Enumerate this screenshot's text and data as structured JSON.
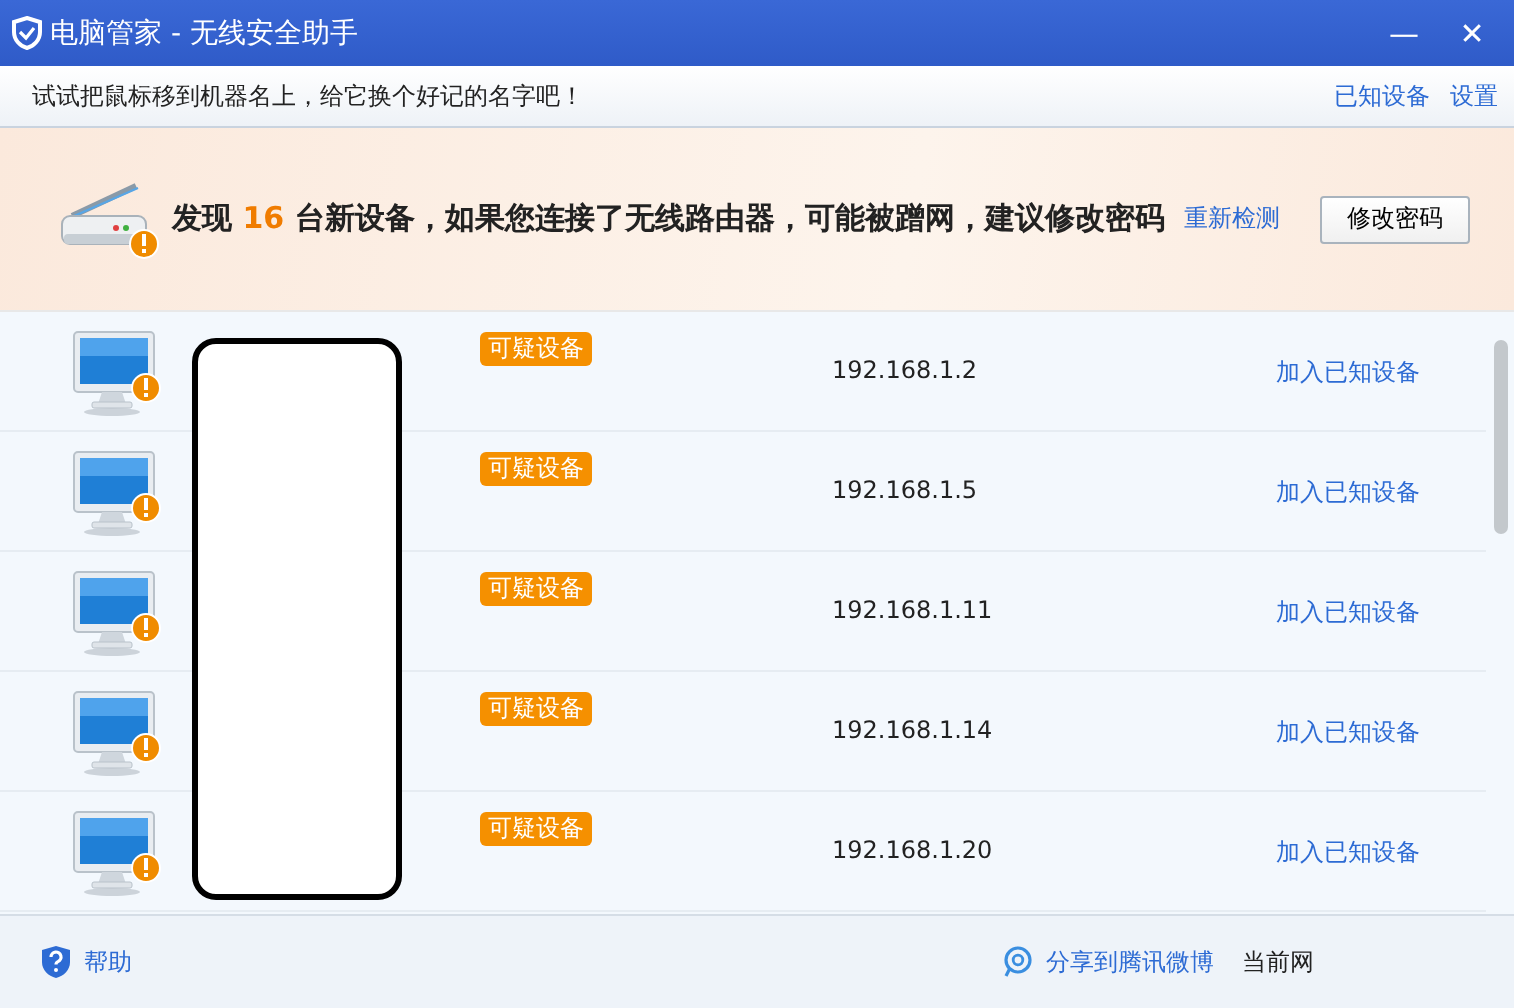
{
  "window": {
    "title": "电脑管家 - 无线安全助手",
    "controls": [
      "—",
      "✕"
    ]
  },
  "tips_bar": {
    "text": "试试把鼠标移到机器名上，给它换个好记的名字吧！",
    "links": [
      "已知设备",
      "设置"
    ]
  },
  "banner": {
    "prefix": "发现",
    "count": "16",
    "message": "台新设备，如果您连接了无线路由器，可能被蹭网，建议修改密码",
    "rescan_link": "重新检测",
    "button": "修改密码"
  },
  "devices": [
    {
      "tag": "可疑设备",
      "ip": "192.168.1.2",
      "action": "加入已知设备"
    },
    {
      "tag": "可疑设备",
      "ip": "192.168.1.5",
      "action": "加入已知设备"
    },
    {
      "tag": "可疑设备",
      "ip": "192.168.1.11",
      "action": "加入已知设备"
    },
    {
      "tag": "可疑设备",
      "ip": "192.168.1.14",
      "action": "加入已知设备"
    },
    {
      "tag": "可疑设备",
      "ip": "192.168.1.20",
      "action": "加入已知设备"
    }
  ],
  "footer": {
    "help": "帮助",
    "share": "分享到腾讯微博",
    "status": "当前网"
  }
}
